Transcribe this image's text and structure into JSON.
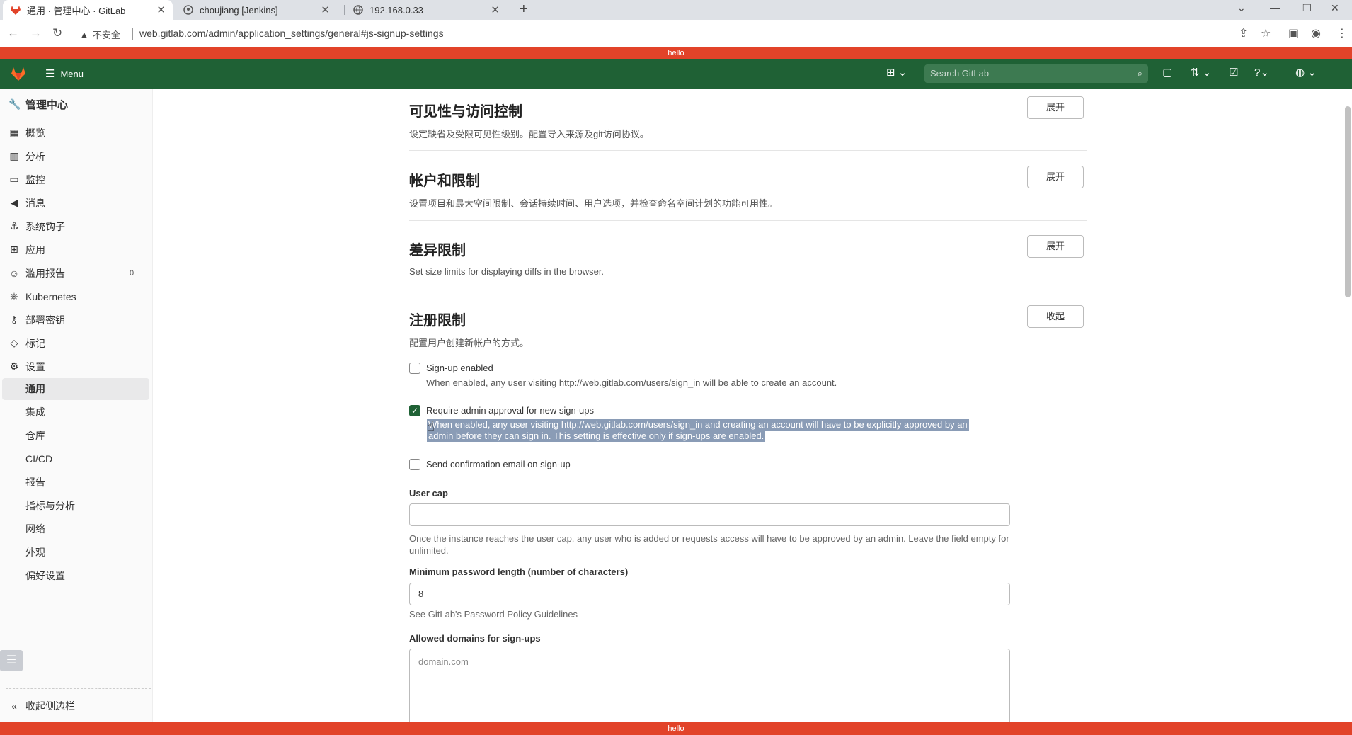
{
  "browser": {
    "tabs": [
      {
        "title": "通用 · 管理中心 · GitLab",
        "active": true
      },
      {
        "title": "choujiang [Jenkins]",
        "active": false
      },
      {
        "title": "192.168.0.33",
        "active": false
      }
    ],
    "insecure_label": "不安全",
    "url": "web.gitlab.com/admin/application_settings/general#js-signup-settings"
  },
  "banner": {
    "text": "hello"
  },
  "header": {
    "menu_label": "Menu",
    "search_placeholder": "Search GitLab",
    "colors": {
      "bg": "#1f6135",
      "banner": "#e24329"
    }
  },
  "sidebar": {
    "title": "管理中心",
    "items": [
      {
        "label": "概览",
        "icon": "overview-icon"
      },
      {
        "label": "分析",
        "icon": "analytics-icon"
      },
      {
        "label": "监控",
        "icon": "monitor-icon"
      },
      {
        "label": "消息",
        "icon": "messages-icon"
      },
      {
        "label": "系统钩子",
        "icon": "hook-icon"
      },
      {
        "label": "应用",
        "icon": "applications-icon"
      },
      {
        "label": "滥用报告",
        "icon": "abuse-icon",
        "badge": "0"
      },
      {
        "label": "Kubernetes",
        "icon": "kubernetes-icon"
      },
      {
        "label": "部署密钥",
        "icon": "key-icon"
      },
      {
        "label": "标记",
        "icon": "label-icon"
      },
      {
        "label": "设置",
        "icon": "settings-icon"
      }
    ],
    "sub_items": [
      "通用",
      "集成",
      "仓库",
      "CI/CD",
      "报告",
      "指标与分析",
      "网络",
      "外观",
      "偏好设置"
    ],
    "collapse_label": "收起侧边栏"
  },
  "sections": [
    {
      "title": "可见性与访问控制",
      "desc": "设定缺省及受限可见性级别。配置导入来源及git访问协议。",
      "button": "展开"
    },
    {
      "title": "帐户和限制",
      "desc": "设置项目和最大空间限制、会话持续时间、用户选项，并检查命名空间计划的功能可用性。",
      "button": "展开"
    },
    {
      "title": "差异限制",
      "desc": "Set size limits for displaying diffs in the browser.",
      "button": "展开"
    },
    {
      "title": "注册限制",
      "desc": "配置用户创建新帐户的方式。",
      "button": "收起"
    }
  ],
  "signup": {
    "signup_enabled": {
      "label": "Sign-up enabled",
      "checked": false,
      "help": "When enabled, any user visiting http://web.gitlab.com/users/sign_in will be able to create an account."
    },
    "require_approval": {
      "label": "Require admin approval for new sign-ups",
      "checked": true,
      "help_line1": "When enabled, any user visiting http://web.gitlab.com/users/sign_in and creating an account will have to be explicitly approved by an",
      "help_line2": "admin before they can sign in. This setting is effective only if sign-ups are enabled."
    },
    "send_confirmation": {
      "label": "Send confirmation email on sign-up",
      "checked": false
    },
    "user_cap": {
      "label": "User cap",
      "value": "",
      "help": "Once the instance reaches the user cap, any user who is added or requests access will have to be approved by an admin. Leave the field empty for unlimited."
    },
    "min_password": {
      "label": "Minimum password length (number of characters)",
      "value": "8",
      "help": "See GitLab's Password Policy Guidelines"
    },
    "allowed_domains": {
      "label": "Allowed domains for sign-ups",
      "placeholder": "domain.com"
    }
  }
}
